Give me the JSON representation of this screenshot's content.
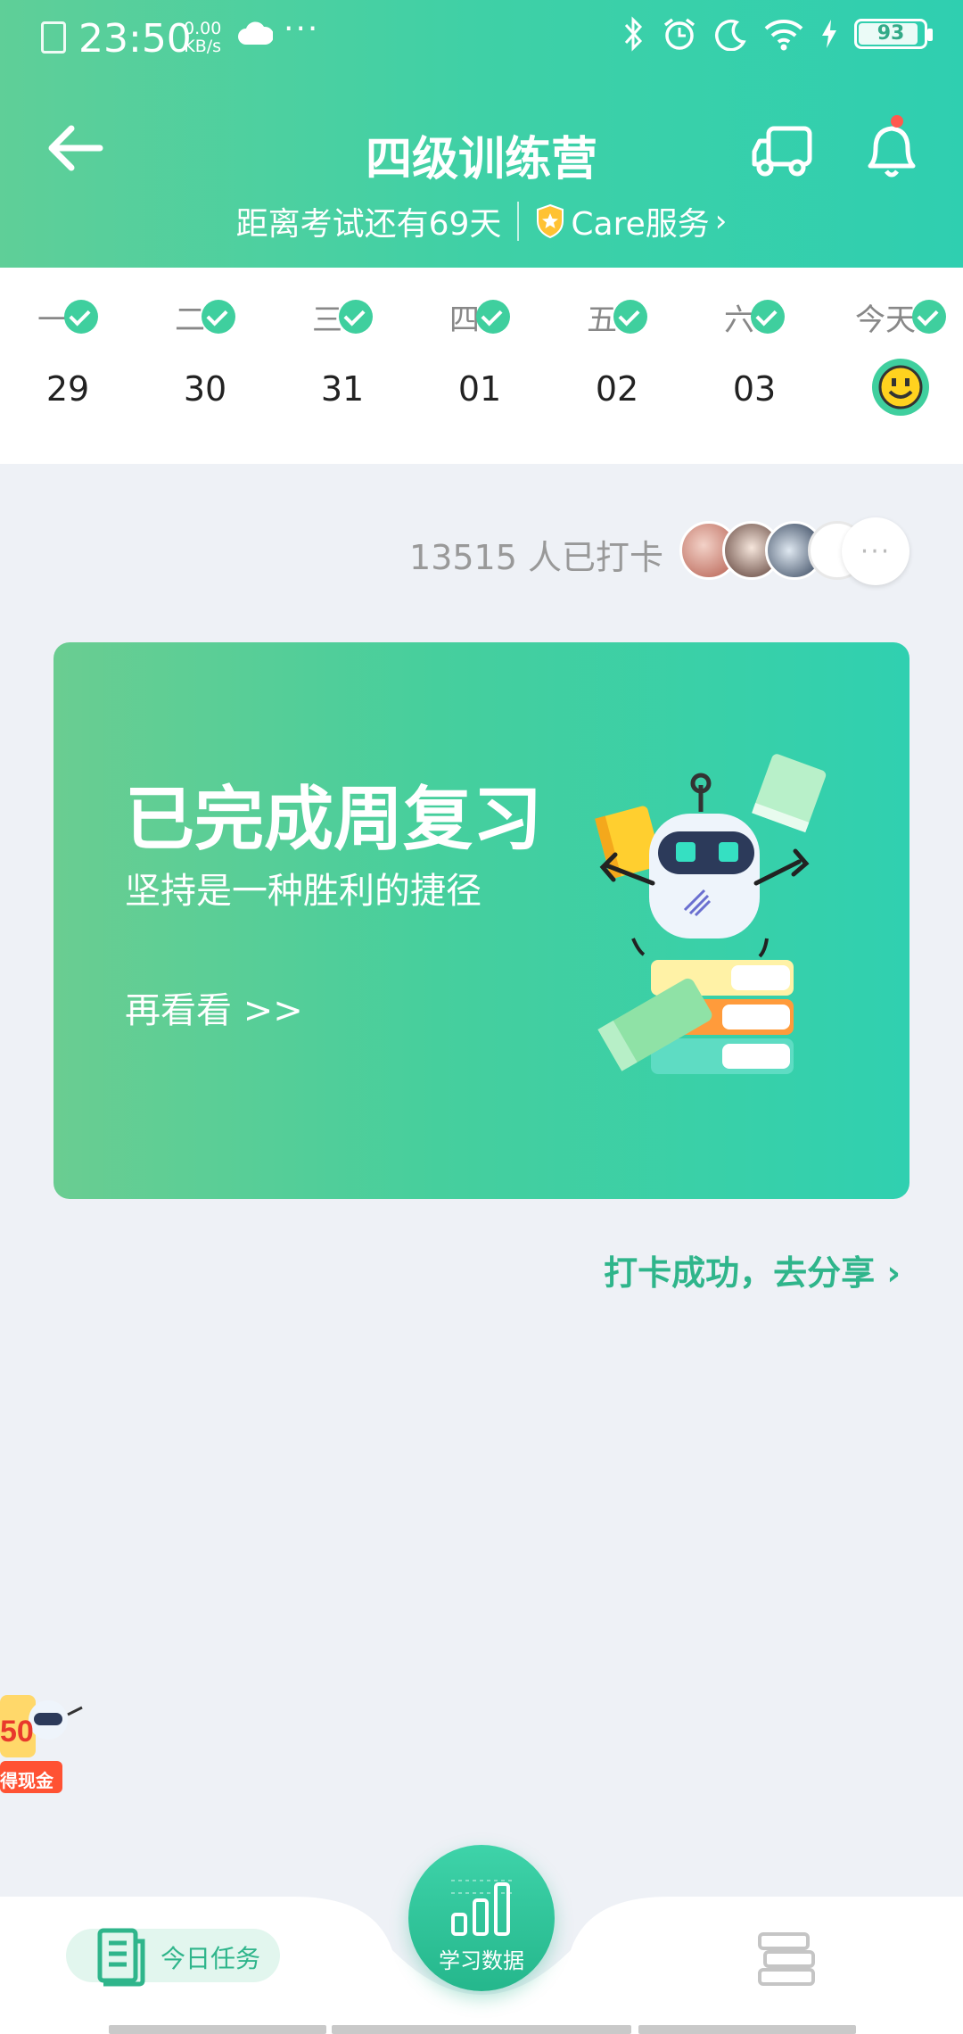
{
  "status": {
    "time": "23:50",
    "speed_value": "0.00",
    "speed_unit": "KB/s",
    "battery": "93"
  },
  "header": {
    "title": "四级训练营",
    "countdown": "距离考试还有69天",
    "care": "Care服务",
    "chevron": "›"
  },
  "week": {
    "days": [
      {
        "label": "一",
        "num": "29"
      },
      {
        "label": "二",
        "num": "30"
      },
      {
        "label": "三",
        "num": "31"
      },
      {
        "label": "四",
        "num": "01"
      },
      {
        "label": "五",
        "num": "02"
      },
      {
        "label": "六",
        "num": "03"
      },
      {
        "label": "今天",
        "num": ""
      }
    ]
  },
  "checkin": {
    "count": "13515 人已打卡",
    "more": "···"
  },
  "card": {
    "title": "已完成周复习",
    "subtitle": "坚持是一种胜利的捷径",
    "link": "再看看 >>"
  },
  "share": {
    "label": "打卡成功，去分享 ›"
  },
  "promo": {
    "amount": "50",
    "label": "得现金"
  },
  "tabbar": {
    "today": "今日任务",
    "data": "学习数据"
  },
  "colors": {
    "accent": "#3fcf9e",
    "accent_dark": "#2fb58b",
    "bg": "#eef1f6"
  }
}
